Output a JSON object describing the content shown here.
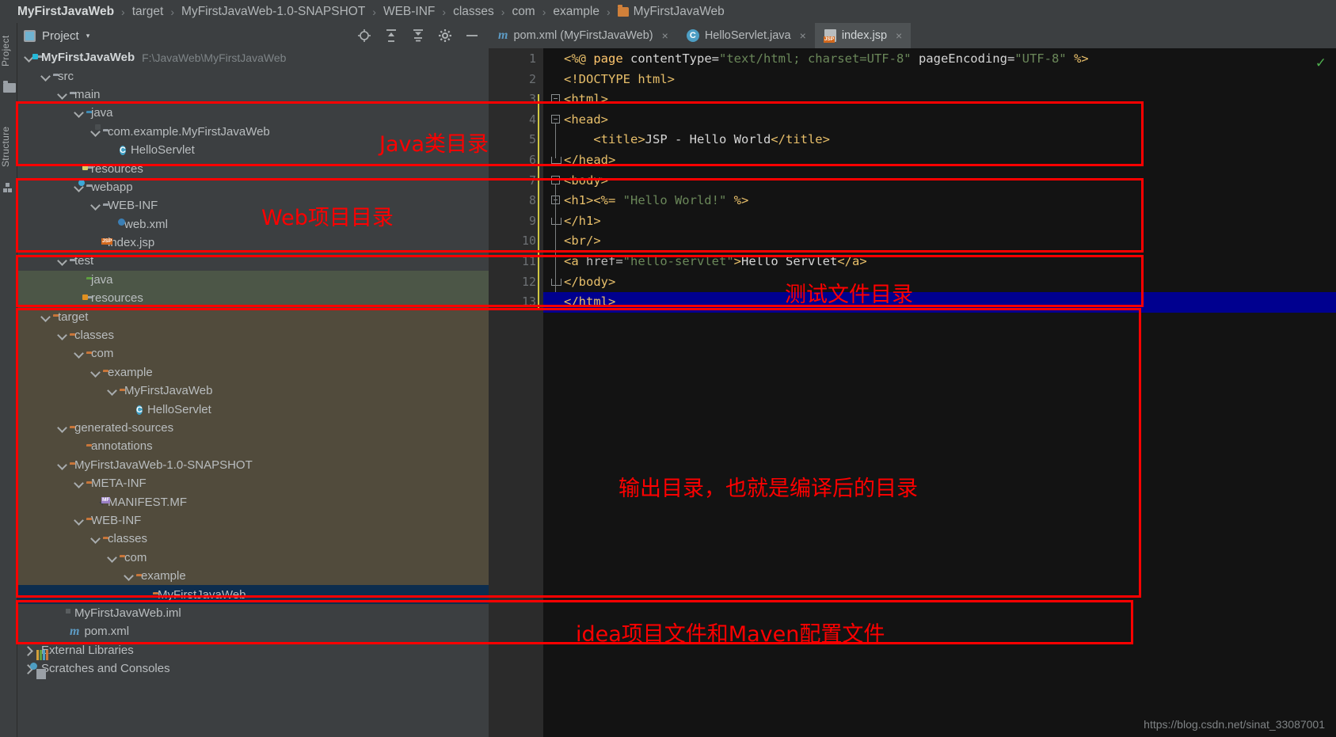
{
  "breadcrumb": {
    "items": [
      {
        "label": "MyFirstJavaWeb",
        "bold": true,
        "icon": null
      },
      {
        "label": "target",
        "bold": false,
        "icon": null
      },
      {
        "label": "MyFirstJavaWeb-1.0-SNAPSHOT",
        "bold": false,
        "icon": null
      },
      {
        "label": "WEB-INF",
        "bold": false,
        "icon": null
      },
      {
        "label": "classes",
        "bold": false,
        "icon": null
      },
      {
        "label": "com",
        "bold": false,
        "icon": null
      },
      {
        "label": "example",
        "bold": false,
        "icon": null
      },
      {
        "label": "MyFirstJavaWeb",
        "bold": false,
        "icon": "folder-orange-icon"
      }
    ],
    "separator": "›"
  },
  "left_strip": {
    "project_tab": "Project",
    "structure_tab": "Structure"
  },
  "panel": {
    "title": "Project",
    "chevron": "▾",
    "tools": [
      "locate-icon",
      "expand-all-icon",
      "collapse-all-icon",
      "settings-gear-icon",
      "hide-minus-icon"
    ]
  },
  "editor_tabs": [
    {
      "label": "pom.xml (MyFirstJavaWeb)",
      "icon": "maven-m-icon",
      "active": false,
      "close": "×"
    },
    {
      "label": "HelloServlet.java",
      "icon": "java-class-icon",
      "active": false,
      "close": "×"
    },
    {
      "label": "index.jsp",
      "icon": "jsp-file-icon",
      "active": true,
      "close": "×"
    }
  ],
  "tree": [
    {
      "indent": 0,
      "arrow": "down",
      "icon": "folder-module-icon",
      "label": "MyFirstJavaWeb",
      "bold": true,
      "path": "F:\\JavaWeb\\MyFirstJavaWeb",
      "bg": "none"
    },
    {
      "indent": 1,
      "arrow": "down",
      "icon": "folder-icon",
      "label": "src",
      "bold": false,
      "bg": "none"
    },
    {
      "indent": 2,
      "arrow": "down",
      "icon": "folder-icon",
      "label": "main",
      "bold": false,
      "bg": "none"
    },
    {
      "indent": 3,
      "arrow": "down",
      "icon": "folder-source-blue-icon",
      "label": "java",
      "bold": false,
      "bg": "none"
    },
    {
      "indent": 4,
      "arrow": "down",
      "icon": "package-icon",
      "label": "com.example.MyFirstJavaWeb",
      "bold": false,
      "bg": "none"
    },
    {
      "indent": 5,
      "arrow": "none",
      "icon": "java-class-icon",
      "label": "HelloServlet",
      "bold": false,
      "bg": "none"
    },
    {
      "indent": 3,
      "arrow": "none",
      "icon": "folder-resources-icon",
      "label": "resources",
      "bold": false,
      "bg": "none"
    },
    {
      "indent": 3,
      "arrow": "down",
      "icon": "folder-webapp-icon",
      "label": "webapp",
      "bold": false,
      "bg": "none"
    },
    {
      "indent": 4,
      "arrow": "down",
      "icon": "folder-icon",
      "label": "WEB-INF",
      "bold": false,
      "bg": "none"
    },
    {
      "indent": 5,
      "arrow": "none",
      "icon": "xml-file-icon",
      "label": "web.xml",
      "bold": false,
      "bg": "none"
    },
    {
      "indent": 4,
      "arrow": "none",
      "icon": "jsp-file-icon",
      "label": "index.jsp",
      "bold": false,
      "bg": "none"
    },
    {
      "indent": 2,
      "arrow": "down",
      "icon": "folder-icon",
      "label": "test",
      "bold": false,
      "bg": "none"
    },
    {
      "indent": 3,
      "arrow": "none",
      "icon": "folder-test-green-icon",
      "label": "java",
      "bold": false,
      "bg": "green"
    },
    {
      "indent": 3,
      "arrow": "none",
      "icon": "folder-test-resources-icon",
      "label": "resources",
      "bold": false,
      "bg": "green"
    },
    {
      "indent": 1,
      "arrow": "down",
      "icon": "folder-orange-icon",
      "label": "target",
      "bold": false,
      "bg": "target"
    },
    {
      "indent": 2,
      "arrow": "down",
      "icon": "folder-orange-icon",
      "label": "classes",
      "bold": false,
      "bg": "target"
    },
    {
      "indent": 3,
      "arrow": "down",
      "icon": "folder-orange-icon",
      "label": "com",
      "bold": false,
      "bg": "target"
    },
    {
      "indent": 4,
      "arrow": "down",
      "icon": "folder-orange-icon",
      "label": "example",
      "bold": false,
      "bg": "target"
    },
    {
      "indent": 5,
      "arrow": "down",
      "icon": "folder-orange-icon",
      "label": "MyFirstJavaWeb",
      "bold": false,
      "bg": "target"
    },
    {
      "indent": 6,
      "arrow": "none",
      "icon": "java-class-icon",
      "label": "HelloServlet",
      "bold": false,
      "bg": "target"
    },
    {
      "indent": 2,
      "arrow": "down",
      "icon": "folder-orange-icon",
      "label": "generated-sources",
      "bold": false,
      "bg": "target"
    },
    {
      "indent": 3,
      "arrow": "none",
      "icon": "folder-orange-icon",
      "label": "annotations",
      "bold": false,
      "bg": "target"
    },
    {
      "indent": 2,
      "arrow": "down",
      "icon": "folder-orange-icon",
      "label": "MyFirstJavaWeb-1.0-SNAPSHOT",
      "bold": false,
      "bg": "target"
    },
    {
      "indent": 3,
      "arrow": "down",
      "icon": "folder-orange-icon",
      "label": "META-INF",
      "bold": false,
      "bg": "target"
    },
    {
      "indent": 4,
      "arrow": "none",
      "icon": "manifest-file-icon",
      "label": "MANIFEST.MF",
      "bold": false,
      "bg": "target"
    },
    {
      "indent": 3,
      "arrow": "down",
      "icon": "folder-orange-icon",
      "label": "WEB-INF",
      "bold": false,
      "bg": "target"
    },
    {
      "indent": 4,
      "arrow": "down",
      "icon": "folder-orange-icon",
      "label": "classes",
      "bold": false,
      "bg": "target"
    },
    {
      "indent": 5,
      "arrow": "down",
      "icon": "folder-orange-icon",
      "label": "com",
      "bold": false,
      "bg": "target"
    },
    {
      "indent": 6,
      "arrow": "down",
      "icon": "folder-orange-icon",
      "label": "example",
      "bold": false,
      "bg": "target"
    },
    {
      "indent": 7,
      "arrow": "none",
      "icon": "folder-orange-icon",
      "label": "MyFirstJavaWeb",
      "bold": false,
      "bg": "blue"
    },
    {
      "indent": 2,
      "arrow": "none",
      "icon": "iml-file-icon",
      "label": "MyFirstJavaWeb.iml",
      "bold": false,
      "bg": "none"
    },
    {
      "indent": 2,
      "arrow": "none",
      "icon": "maven-m-icon",
      "label": "pom.xml",
      "bold": false,
      "bg": "none"
    },
    {
      "indent": 0,
      "arrow": "right",
      "icon": "libraries-icon",
      "label": "External Libraries",
      "bold": false,
      "bg": "none"
    },
    {
      "indent": 0,
      "arrow": "right",
      "icon": "scratches-icon",
      "label": "Scratches and Consoles",
      "bold": false,
      "bg": "none"
    }
  ],
  "code": {
    "lines": [
      {
        "n": 1,
        "indent": 0,
        "fold": "none",
        "tokens": [
          {
            "t": "<%@ ",
            "c": "tag"
          },
          {
            "t": "page ",
            "c": "jsp"
          },
          {
            "t": "contentType=",
            "c": "white"
          },
          {
            "t": "\"text/html; charset=UTF-8\"",
            "c": "str"
          },
          {
            "t": " pageEncoding=",
            "c": "white"
          },
          {
            "t": "\"UTF-8\"",
            "c": "str"
          },
          {
            "t": " %>",
            "c": "tag"
          }
        ]
      },
      {
        "n": 2,
        "indent": 0,
        "fold": "none",
        "tokens": [
          {
            "t": "<!DOCTYPE html>",
            "c": "tag"
          }
        ]
      },
      {
        "n": 3,
        "indent": 0,
        "fold": "open",
        "tokens": [
          {
            "t": "<html>",
            "c": "tag"
          }
        ]
      },
      {
        "n": 4,
        "indent": 0,
        "fold": "open",
        "tokens": [
          {
            "t": "<head>",
            "c": "tag"
          }
        ]
      },
      {
        "n": 5,
        "indent": 0,
        "fold": "none",
        "tokens": [
          {
            "t": "    <title>",
            "c": "tag"
          },
          {
            "t": "JSP - Hello World",
            "c": "white"
          },
          {
            "t": "</title>",
            "c": "tag"
          }
        ]
      },
      {
        "n": 6,
        "indent": 0,
        "fold": "close",
        "tokens": [
          {
            "t": "</head>",
            "c": "tag"
          }
        ]
      },
      {
        "n": 7,
        "indent": 0,
        "fold": "open",
        "tokens": [
          {
            "t": "<body>",
            "c": "tag"
          }
        ]
      },
      {
        "n": 8,
        "indent": 0,
        "fold": "open",
        "tokens": [
          {
            "t": "<h1>",
            "c": "tag"
          },
          {
            "t": "<%= ",
            "c": "tag"
          },
          {
            "t": "\"Hello World!\"",
            "c": "str"
          },
          {
            "t": " %>",
            "c": "tag"
          }
        ]
      },
      {
        "n": 9,
        "indent": 0,
        "fold": "close",
        "tokens": [
          {
            "t": "</h1>",
            "c": "tag"
          }
        ]
      },
      {
        "n": 10,
        "indent": 0,
        "fold": "none",
        "tokens": [
          {
            "t": "<br/>",
            "c": "tag"
          }
        ]
      },
      {
        "n": 11,
        "indent": 0,
        "fold": "none",
        "tokens": [
          {
            "t": "<a ",
            "c": "tag"
          },
          {
            "t": "href=",
            "c": "attr"
          },
          {
            "t": "\"hello-servlet\"",
            "c": "str"
          },
          {
            "t": ">",
            "c": "tag"
          },
          {
            "t": "Hello Servlet",
            "c": "white"
          },
          {
            "t": "</a>",
            "c": "tag"
          }
        ]
      },
      {
        "n": 12,
        "indent": 0,
        "fold": "close",
        "tokens": [
          {
            "t": "</body>",
            "c": "tag"
          }
        ]
      },
      {
        "n": 13,
        "indent": 0,
        "fold": "close",
        "tokens": [
          {
            "t": "</html>",
            "c": "tag"
          }
        ],
        "selected": true
      }
    ],
    "inspection_status": "✓"
  },
  "annotations": {
    "accent_color": "#ff0000",
    "labels": [
      {
        "id": "java-dir",
        "text": "Java类目录"
      },
      {
        "id": "web-dir",
        "text": "Web项目目录"
      },
      {
        "id": "test-dir",
        "text": "测试文件目录"
      },
      {
        "id": "output-dir",
        "text": "输出目录，也就是编译后的目录"
      },
      {
        "id": "config-dir",
        "text": "idea项目文件和Maven配置文件"
      }
    ]
  },
  "watermark": "https://blog.csdn.net/sinat_33087001"
}
